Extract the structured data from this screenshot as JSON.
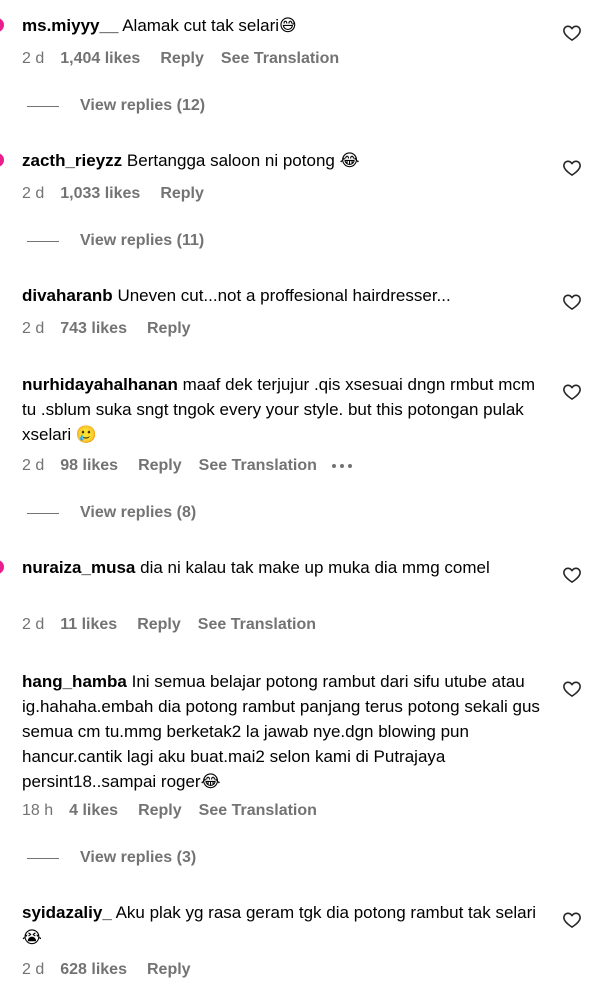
{
  "colors": {
    "meta": "#737373",
    "story_ring": "#e91e8c"
  },
  "comments": [
    {
      "user": "ms.miyyy__",
      "text": "Alamak cut tak selari😅",
      "time": "2 d",
      "likes": "1,404 likes",
      "reply": "Reply",
      "translation": "See Translation"
    },
    {
      "user": "zacth_rieyzz",
      "text": "Bertangga saloon ni potong 😂",
      "time": "2 d",
      "likes": "1,033 likes",
      "reply": "Reply"
    },
    {
      "user": "divaharanb",
      "text": "Uneven cut...not a proffesional hairdresser...",
      "time": "2 d",
      "likes": "743 likes",
      "reply": "Reply"
    },
    {
      "user": "nurhidayahalhanan",
      "text": "maaf dek terjujur .qis xsesuai dngn rmbut mcm tu .sblum suka sngt tngok every your style. but this potongan pulak xselari 🥲",
      "time": "2 d",
      "likes": "98 likes",
      "reply": "Reply",
      "translation": "See Translation"
    },
    {
      "user": "nuraiza_musa",
      "text": "dia ni kalau tak make up muka dia mmg comel",
      "time": "2 d",
      "likes": "11 likes",
      "reply": "Reply",
      "translation": "See Translation"
    },
    {
      "user": "hang_hamba",
      "text": "Ini semua belajar potong rambut dari sifu utube atau ig.hahaha.embah dia potong rambut panjang terus potong sekali gus semua cm tu.mmg berketak2 la jawab nye.dgn blowing pun hancur.cantik lagi aku buat.mai2 selon kami di Putrajaya persint18..sampai roger😂",
      "time": "18 h",
      "likes": "4 likes",
      "reply": "Reply",
      "translation": "See Translation"
    },
    {
      "user": "syidazaliy_",
      "text": "Aku plak yg rasa geram tgk dia potong rambut tak selari😭",
      "time": "2 d",
      "likes": "628 likes",
      "reply": "Reply"
    }
  ],
  "view_replies": [
    "View replies (12)",
    "View replies (11)",
    "View replies (8)",
    "View replies (3)"
  ]
}
